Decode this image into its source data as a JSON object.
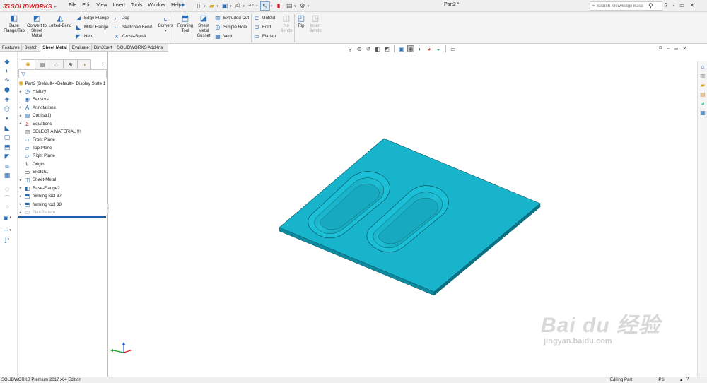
{
  "app": {
    "logo_text": "SOLIDWORKS",
    "logo_mark": "3S",
    "document_title": "Part2 *",
    "menu": [
      "File",
      "Edit",
      "View",
      "Insert",
      "Tools",
      "Window",
      "Help"
    ],
    "search_placeholder": "Search Knowledge Base",
    "window_controls": [
      "?",
      "-",
      "▭",
      "✕"
    ]
  },
  "command_manager": {
    "big_buttons": [
      {
        "label": "Base Flange/Tab",
        "icon": "base-flange-icon",
        "disabled": false
      },
      {
        "label": "Convert to Sheet Metal",
        "icon": "convert-sheet-metal-icon",
        "disabled": false
      },
      {
        "label": "Lofted-Bend",
        "icon": "lofted-bend-icon",
        "disabled": false
      },
      {
        "label": "Corners",
        "icon": "corners-icon",
        "disabled": false
      },
      {
        "label": "Forming Tool",
        "icon": "forming-tool-icon",
        "disabled": false
      },
      {
        "label": "Sheet Metal Gusset",
        "icon": "gusset-icon",
        "disabled": false
      },
      {
        "label": "No Bends",
        "icon": "no-bends-icon",
        "disabled": true
      },
      {
        "label": "Rip",
        "icon": "rip-icon",
        "disabled": false
      },
      {
        "label": "Insert Bends",
        "icon": "insert-bends-icon",
        "disabled": true
      }
    ],
    "small_col1": [
      "Edge Flange",
      "Miter Flange",
      "Hem"
    ],
    "small_col2": [
      "Jog",
      "Sketched Bend",
      "Cross-Break"
    ],
    "small_col3": [
      "Extruded Cut",
      "Simple Hole",
      "Vent"
    ],
    "small_col4": [
      "Unfold",
      "Fold",
      "Flatten"
    ]
  },
  "tabs": [
    "Features",
    "Sketch",
    "Sheet Metal",
    "Evaluate",
    "DimXpert",
    "SOLIDWORKS Add-Ins"
  ],
  "active_tab": "Sheet Metal",
  "feature_tree": {
    "root": "Part2  (Default<<Default>_Display State 1",
    "items": [
      {
        "label": "History",
        "icon": "history-icon",
        "expandable": true
      },
      {
        "label": "Sensors",
        "icon": "sensors-icon",
        "expandable": false
      },
      {
        "label": "Annotations",
        "icon": "annotations-icon",
        "expandable": true
      },
      {
        "label": "Cut list(1)",
        "icon": "cut-list-icon",
        "expandable": true
      },
      {
        "label": "Equations",
        "icon": "equations-icon",
        "expandable": true
      },
      {
        "label": "SELECT A MATERIAL !!!",
        "icon": "material-icon",
        "expandable": false
      },
      {
        "label": "Front Plane",
        "icon": "plane-icon",
        "expandable": false
      },
      {
        "label": "Top Plane",
        "icon": "plane-icon",
        "expandable": false
      },
      {
        "label": "Right Plane",
        "icon": "plane-icon",
        "expandable": false
      },
      {
        "label": "Origin",
        "icon": "origin-icon",
        "expandable": false
      },
      {
        "label": "Sketch1",
        "icon": "sketch-icon",
        "expandable": false
      },
      {
        "label": "Sheet-Metal",
        "icon": "sheet-metal-icon",
        "expandable": true
      },
      {
        "label": "Base-Flange2",
        "icon": "base-flange-feature-icon",
        "expandable": true
      },
      {
        "label": "forming tool 37",
        "icon": "forming-tool-feature-icon",
        "expandable": true
      },
      {
        "label": "forming tool 38",
        "icon": "forming-tool-feature-icon",
        "expandable": true
      },
      {
        "label": "Flat-Pattern",
        "icon": "flat-pattern-icon",
        "expandable": true,
        "suppressed": true
      }
    ]
  },
  "model": {
    "face_color": "#17b4cc",
    "edge_color": "#0a5560"
  },
  "watermark": {
    "brand": "Bai du 经验",
    "url": "jingyan.baidu.com"
  },
  "status": {
    "left": "SOLIDWORKS Premium 2017 x64 Edition",
    "mode": "Editing Part",
    "units": "IPS",
    "help": "?"
  }
}
